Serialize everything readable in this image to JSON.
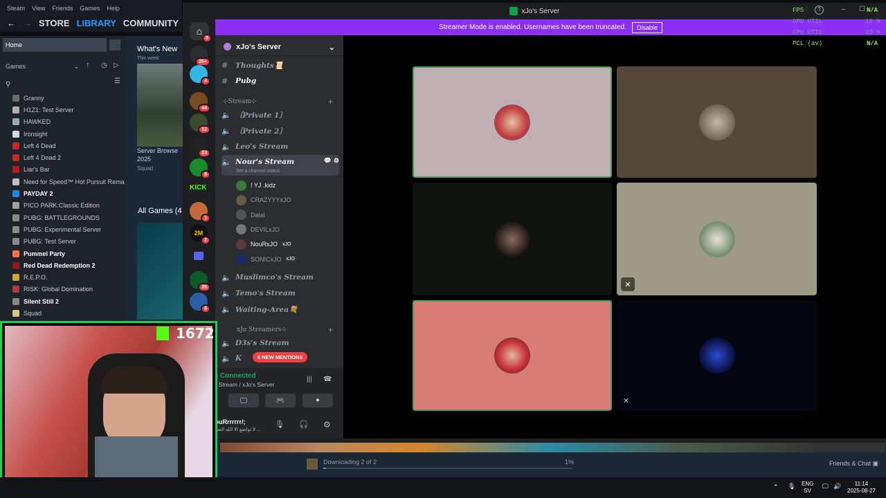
{
  "steam": {
    "menubar": [
      "Steam",
      "View",
      "Friends",
      "Games",
      "Help"
    ],
    "nav": {
      "store": "STORE",
      "library": "LIBRARY",
      "community": "COMMUNITY"
    },
    "home": "Home",
    "games_filter": "Games",
    "games": [
      {
        "name": "Granny",
        "bold": false
      },
      {
        "name": "H1Z1: Test Server",
        "bold": false
      },
      {
        "name": "HAWKED",
        "bold": false
      },
      {
        "name": "Ironsight",
        "bold": false
      },
      {
        "name": "Left 4 Dead",
        "bold": false
      },
      {
        "name": "Left 4 Dead 2",
        "bold": false
      },
      {
        "name": "Liar's Bar",
        "bold": false
      },
      {
        "name": "Need for Speed™ Hot Pursuit Rema",
        "bold": false
      },
      {
        "name": "PAYDAY 2",
        "bold": true
      },
      {
        "name": "PICO PARK:Classic Edition",
        "bold": false
      },
      {
        "name": "PUBG: BATTLEGROUNDS",
        "bold": false
      },
      {
        "name": "PUBG: Experimental Server",
        "bold": false
      },
      {
        "name": "PUBG: Test Server",
        "bold": false
      },
      {
        "name": "Pummel Party",
        "bold": true
      },
      {
        "name": "Red Dead Redemption 2",
        "bold": true
      },
      {
        "name": "R.E.P.O.",
        "bold": false
      },
      {
        "name": "RISK: Global Domination",
        "bold": false
      },
      {
        "name": "Silent Still 2",
        "bold": true
      },
      {
        "name": "Squad",
        "bold": false
      }
    ],
    "whats_new": "What's New",
    "this_week": "This week",
    "tile_title": "Server Browse 2025",
    "tile_sub": "Squad",
    "all_games": "All Games (4",
    "download_text": "Downloading 2 of 2",
    "download_pct": "1%",
    "download_progress": 0.01,
    "friends_chat": "Friends & Chat"
  },
  "discord": {
    "title": "xJo's Server",
    "banner": "Streamer Mode is enabled. Usernames have been truncated.",
    "disable": "Disable",
    "server_name": "xJo's Server",
    "server_badges": [
      "8",
      "25+",
      "4",
      "44",
      "12",
      "23",
      "8",
      "",
      "1",
      "2",
      "",
      "26",
      "6"
    ],
    "text_channels": [
      "Thoughts📜",
      "Pubg"
    ],
    "category1": "⊹Stream⊹",
    "voice_channels1": [
      "〔Private 1〕",
      "〔Private 2〕",
      "Leo's Stream"
    ],
    "active_channel": "Nour's Stream",
    "channel_status": "Set a channel status",
    "members": [
      {
        "name": "! YJ .kidz",
        "tag": "",
        "on": true
      },
      {
        "name": "CRAZYYYxJO",
        "tag": "",
        "on": false
      },
      {
        "name": "Dalal",
        "tag": "",
        "on": false
      },
      {
        "name": "DEVILxJO",
        "tag": "",
        "on": false
      },
      {
        "name": "NouRxJO",
        "tag": "xJO",
        "on": true
      },
      {
        "name": "SONICxJO",
        "tag": "xJO",
        "on": false
      }
    ],
    "voice_channels2": [
      "Muslimco's Stream",
      "Temo's Stream",
      "Waiting-Area💐"
    ],
    "category2": "xJo Streamers⊹",
    "voice_channels3": [
      "D3s's Stream",
      "K"
    ],
    "mentions": "5 NEW MENTIONS",
    "voice_connected": "ce Connected",
    "voice_location_channel": "r' : Stream",
    "voice_location_server": "/ xJo's Server",
    "user_name": "NouRrrrrrr/;",
    "user_status": "لا تواضع الا الله العظيم ...",
    "fps_labels": [
      "FPS",
      "GPU UTIL",
      "CPU UTIL",
      "PCL (av)"
    ],
    "fps_values": [
      "N/A",
      "19 %",
      "13 %",
      "N/A"
    ]
  },
  "webcam": {
    "kick_count": "1672"
  },
  "taskbar": {
    "lang": "ENG",
    "lang2": "SV",
    "time": "11:14",
    "date": "2025-08-27"
  },
  "colors": {
    "discord_accent": "#8b2ff2",
    "speaking": "#43a25a",
    "steam_blue": "#1a9fff",
    "kick_green": "#13d64a"
  }
}
